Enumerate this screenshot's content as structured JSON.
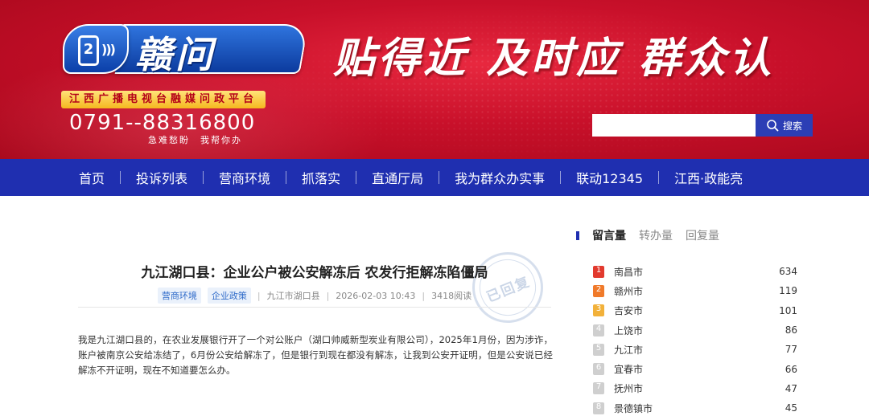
{
  "header": {
    "logo_text": "赣问",
    "logo_badge_number": "2",
    "platform_name": "江西广播电视台融媒问政平台",
    "hotline": "0791--88316800",
    "hotline_sub": "急难愁盼　我帮你办",
    "slogan": "贴得近 及时应 群众认",
    "search": {
      "placeholder": "",
      "button_label": "搜索"
    },
    "colors": {
      "banner_red": "#c8102a",
      "nav_blue": "#1f2fb0",
      "search_blue": "#2c3eb5",
      "gold": "#f5b81f"
    }
  },
  "nav": {
    "items": [
      {
        "label": "首页"
      },
      {
        "label": "投诉列表"
      },
      {
        "label": "营商环境"
      },
      {
        "label": "抓落实"
      },
      {
        "label": "直通厅局"
      },
      {
        "label": "我为群众办实事"
      },
      {
        "label": "联动12345"
      },
      {
        "label": "江西·政能亮"
      }
    ]
  },
  "article": {
    "title": "九江湖口县：企业公户被公安解冻后 农发行拒解冻陷僵局",
    "tags": [
      "营商环境",
      "企业政策"
    ],
    "location": "九江市湖口县",
    "datetime": "2026-02-03 10:43",
    "reads": "3418阅读",
    "stamp": "已回复",
    "body": "我是九江湖口县的，在农业发展银行开了一个对公账户（湖口帅威新型炭业有限公司），2025年1月份，因为涉诈，账户被南京公安给冻结了，6月份公安给解冻了，但是银行到现在都没有解冻，让我到公安开证明，但是公安说已经解冻不开证明，现在不知道要怎么办。"
  },
  "ranking": {
    "tabs": [
      {
        "label": "留言量",
        "active": true
      },
      {
        "label": "转办量",
        "active": false
      },
      {
        "label": "回复量",
        "active": false
      }
    ],
    "rank_colors": {
      "first": "#e23a2e",
      "second": "#f07a2a",
      "third": "#f2b13a",
      "other": "#cfcfcf"
    },
    "items": [
      {
        "rank": "1",
        "name": "南昌市",
        "count": "634"
      },
      {
        "rank": "2",
        "name": "赣州市",
        "count": "119"
      },
      {
        "rank": "3",
        "name": "吉安市",
        "count": "101"
      },
      {
        "rank": "4",
        "name": "上饶市",
        "count": "86"
      },
      {
        "rank": "5",
        "name": "九江市",
        "count": "77"
      },
      {
        "rank": "6",
        "name": "宜春市",
        "count": "66"
      },
      {
        "rank": "7",
        "name": "抚州市",
        "count": "47"
      },
      {
        "rank": "8",
        "name": "景德镇市",
        "count": "45"
      }
    ]
  }
}
